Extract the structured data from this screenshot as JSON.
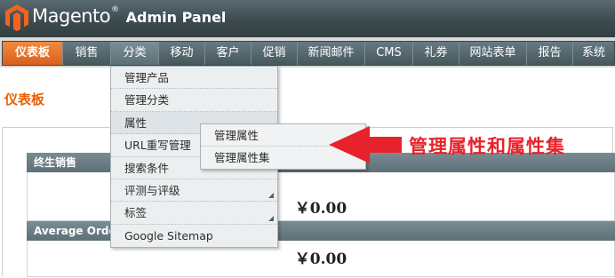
{
  "header": {
    "logo": "Magento",
    "logo_mark": "®",
    "subtitle": "Admin Panel"
  },
  "nav": {
    "items": [
      {
        "label": "仪表板"
      },
      {
        "label": "销售"
      },
      {
        "label": "分类"
      },
      {
        "label": "移动"
      },
      {
        "label": "客户"
      },
      {
        "label": "促销"
      },
      {
        "label": "新闻邮件"
      },
      {
        "label": "CMS"
      },
      {
        "label": "礼券"
      },
      {
        "label": "网站表单"
      },
      {
        "label": "报告"
      },
      {
        "label": "系统"
      }
    ]
  },
  "page": {
    "title": "仪表板"
  },
  "panels": [
    {
      "title": "终生销售",
      "value": "￥0.00"
    },
    {
      "title": "Average Orders",
      "value": "￥0.00"
    }
  ],
  "dropdown": {
    "items": [
      {
        "label": "管理产品"
      },
      {
        "label": "管理分类"
      },
      {
        "label": "属性"
      },
      {
        "label": "URL重写管理"
      },
      {
        "label": "搜索条件"
      },
      {
        "label": "评测与评级"
      },
      {
        "label": "标签"
      },
      {
        "label": "Google Sitemap"
      }
    ]
  },
  "submenu": {
    "items": [
      {
        "label": "管理属性"
      },
      {
        "label": "管理属性集"
      }
    ]
  },
  "annotation": {
    "text": "管理属性和属性集",
    "color": "#e8222a"
  },
  "colors": {
    "accent": "#eb5e00",
    "nav_active": "#e36c22"
  }
}
